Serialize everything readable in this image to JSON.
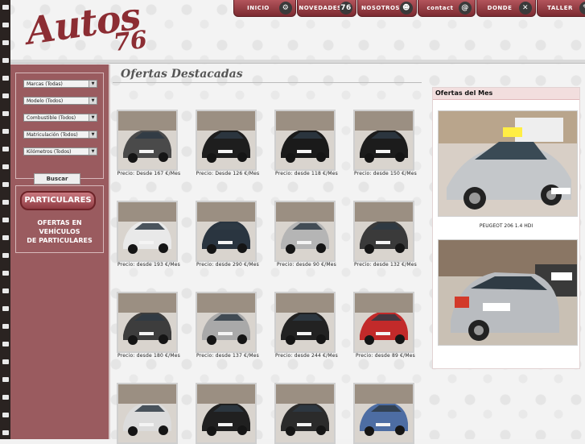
{
  "logo": {
    "word": "Autos",
    "number": "76"
  },
  "nav": [
    {
      "label": "INICIO",
      "icon": "gear-icon",
      "glyph": "⚙"
    },
    {
      "label": "NOVEDADES",
      "icon": "badge-76-icon",
      "glyph": "76"
    },
    {
      "label": "NOSOTROS",
      "icon": "person-icon",
      "glyph": "☻"
    },
    {
      "label": "contact",
      "icon": "at-icon",
      "glyph": "@"
    },
    {
      "label": "DONDE",
      "icon": "road-icon",
      "glyph": "✕"
    },
    {
      "label": "TALLER",
      "icon": "wrench-icon",
      "glyph": "✎"
    }
  ],
  "filters": [
    {
      "label": "Marcas (Todas)"
    },
    {
      "label": "Modelo (Todos)"
    },
    {
      "label": "Combustible (Todos)"
    },
    {
      "label": "Matriculación (Todos)"
    },
    {
      "label": "Kilómetros (Todos)"
    }
  ],
  "search_label": "Buscar",
  "particulares": {
    "button": "PARTICULARES",
    "text": "OFERTAS EN\nVEHÍCULOS\nDE PARTICULARES"
  },
  "main_title": "Ofertas Destacadas",
  "cars": [
    {
      "price": "Precio: Desde 167 €/Mes",
      "color": "#4a4a4a"
    },
    {
      "price": "Precio: Desde 126 €/Mes",
      "color": "#1e1e1e"
    },
    {
      "price": "Precio: desde 118 €/Mes",
      "color": "#1a1a1a"
    },
    {
      "price": "Precio: desde 150 €/Mes",
      "color": "#1c1c1c"
    },
    {
      "price": "Precio: desde 193 €/Mes",
      "color": "#e9e9e9"
    },
    {
      "price": "Precio: desde 290 €/Mes",
      "color": "#2a3540"
    },
    {
      "price": "Precio: desde 90 €/Mes",
      "color": "#b5b5b5"
    },
    {
      "price": "Precio: desde 132 €/Mes",
      "color": "#3a3a3a"
    },
    {
      "price": "Precio: desde 180 €/Mes",
      "color": "#3d3d3d"
    },
    {
      "price": "Precio: desde 137 €/Mes",
      "color": "#a9a9a9"
    },
    {
      "price": "Precio: desde 244 €/Mes",
      "color": "#222222"
    },
    {
      "price": "Precio: desde 89 €/Mes",
      "color": "#c22a2a"
    },
    {
      "price": "",
      "color": "#dcdcdc"
    },
    {
      "price": "",
      "color": "#202020"
    },
    {
      "price": "",
      "color": "#2b2b2b"
    },
    {
      "price": "",
      "color": "#4d6da3"
    }
  ],
  "offers": {
    "title": "Ofertas del Mes",
    "caption": "PEUGEOT 206 1.4 HDI"
  },
  "colors": {
    "brand": "#8c2d33",
    "sidebar": "#9a5b5f"
  }
}
